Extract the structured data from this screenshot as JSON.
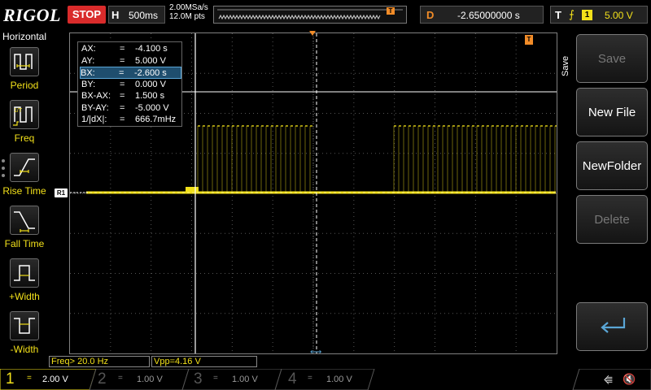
{
  "top": {
    "logo": "RIGOL",
    "run_state": "STOP",
    "horizontal_label": "H",
    "timebase": "500ms",
    "sample_rate": "2.00MSa/s",
    "memory_depth": "12.0M pts",
    "delay_label": "D",
    "delay_value": "-2.65000000 s",
    "trigger_label": "T",
    "trigger_edge_icon": "rising-edge-icon",
    "trigger_source": "1",
    "trigger_level": "5.00 V"
  },
  "left_menu": {
    "title": "Horizontal",
    "items": [
      {
        "label": "Period",
        "icon": "period-icon"
      },
      {
        "label": "Freq",
        "icon": "frequency-icon"
      },
      {
        "label": "Rise Time",
        "icon": "rise-time-icon"
      },
      {
        "label": "Fall Time",
        "icon": "fall-time-icon"
      },
      {
        "label": "+Width",
        "icon": "positive-width-icon"
      },
      {
        "label": "-Width",
        "icon": "negative-width-icon"
      }
    ]
  },
  "cursor": {
    "rows": [
      {
        "k": "AX:",
        "v": "-4.100 s"
      },
      {
        "k": "AY:",
        "v": "5.000 V"
      },
      {
        "k": "BX:",
        "v": "-2.600 s"
      },
      {
        "k": "BY:",
        "v": "0.000 V"
      },
      {
        "k": "BX-AX:",
        "v": "1.500 s"
      },
      {
        "k": "BY-AY:",
        "v": "-5.000 V"
      },
      {
        "k": "1/|dX|:",
        "v": "666.7mHz"
      }
    ],
    "equals": "="
  },
  "markers": {
    "ch1": "R1",
    "trigger": "T"
  },
  "measurements": {
    "freq": "Freq> 20.0 Hz",
    "vpp": "Vpp=4.16 V"
  },
  "right_menu": {
    "title": "Save",
    "buttons": [
      {
        "label": "Save",
        "enabled": false
      },
      {
        "label": "New File",
        "enabled": true
      },
      {
        "label": "NewFolder",
        "enabled": true
      },
      {
        "label": "Delete",
        "enabled": false
      }
    ],
    "back_icon": "return-icon"
  },
  "channels": [
    {
      "num": "1",
      "coupling": "=",
      "scale": "2.00 V",
      "color": "#f2e01a",
      "active": true
    },
    {
      "num": "2",
      "coupling": "=",
      "scale": "1.00 V",
      "color": "#00c8e6",
      "active": false
    },
    {
      "num": "3",
      "coupling": "=",
      "scale": "1.00 V",
      "color": "#e63ce6",
      "active": false
    },
    {
      "num": "4",
      "coupling": "=",
      "scale": "1.00 V",
      "color": "#3c7ce6",
      "active": false
    }
  ],
  "status_icons": {
    "usb": "usb-icon",
    "sound": "speaker-muted-icon"
  },
  "colors": {
    "ch1": "#f2e01a",
    "trigger": "#f28c28",
    "stop": "#d92b2b",
    "cursor_sel": "#1f4e6e"
  }
}
